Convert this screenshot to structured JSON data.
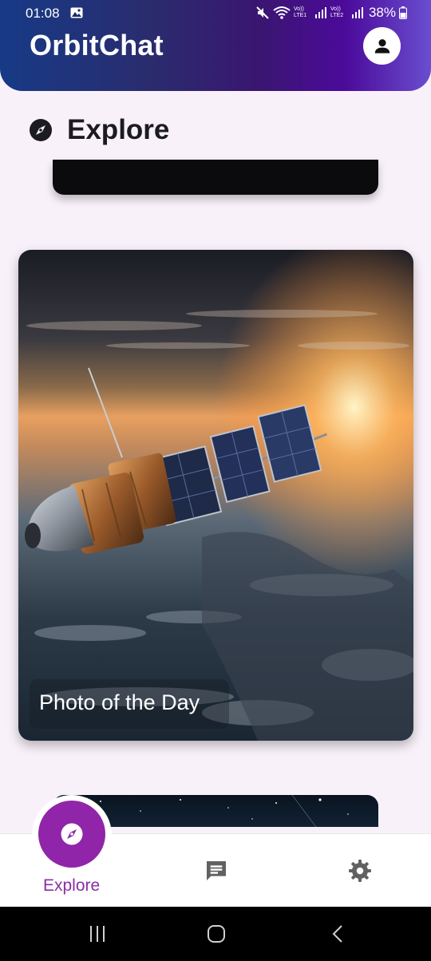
{
  "status_bar": {
    "time": "01:08",
    "battery": "38%",
    "sim1_label": "Vo)) LTE1",
    "sim2_label": "Vo)) LTE2"
  },
  "app": {
    "title": "OrbitChat"
  },
  "explore": {
    "heading": "Explore"
  },
  "card": {
    "caption": "Photo of the Day"
  },
  "bottom_nav": {
    "items": [
      {
        "label": "Explore",
        "icon": "compass-icon",
        "active": true
      },
      {
        "label": "",
        "icon": "chat-icon",
        "active": false
      },
      {
        "label": "",
        "icon": "gear-icon",
        "active": false
      }
    ]
  },
  "colors": {
    "accent": "#9025a9",
    "header_start": "#173a86",
    "header_end": "#6a4ecf",
    "background": "#f9f1f9"
  }
}
